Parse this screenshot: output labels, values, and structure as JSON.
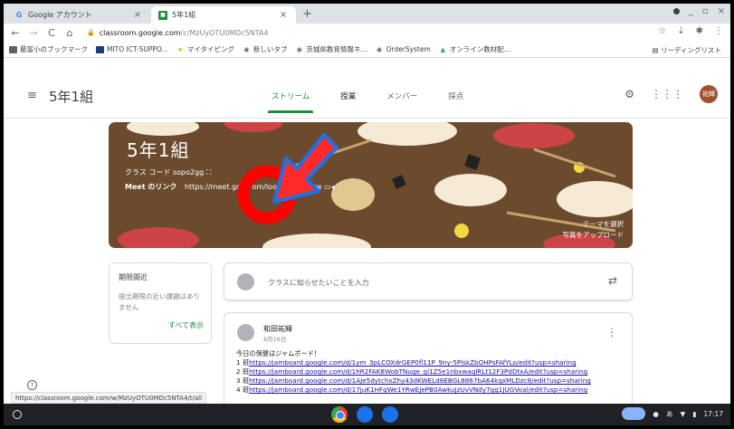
{
  "browser": {
    "tabs": [
      {
        "title": "Google アカウント",
        "active": false
      },
      {
        "title": "5年1組",
        "active": true
      }
    ],
    "address": {
      "host": "classroom.google.com",
      "path": "/c/MzUyOTU0MDc5NTA4"
    },
    "bookmarks": [
      {
        "label": "最富小のブックマーク",
        "icon": "folder-icon"
      },
      {
        "label": "MITO ICT-SUPPO...",
        "icon": "mito-icon"
      },
      {
        "label": "マイタイピング",
        "icon": "star-icon"
      },
      {
        "label": "新しいタブ",
        "icon": "globe-icon"
      },
      {
        "label": "茨城県教育情報ネ...",
        "icon": "globe-icon"
      },
      {
        "label": "OrderSystem",
        "icon": "globe-icon"
      },
      {
        "label": "オンライン教材配...",
        "icon": "green-icon"
      }
    ],
    "reading_list": "リーディングリスト",
    "status_url": "https://classroom.google.com/w/MzUyOTU0MDc5NTA4/t/all"
  },
  "classroom": {
    "class_name": "5年1組",
    "tabs": [
      "ストリーム",
      "授業",
      "メンバー",
      "採点"
    ],
    "avatar_text": "祐輝",
    "banner": {
      "title": "5年1組",
      "class_code_label": "クラス コード",
      "class_code": "sopo2gg",
      "meet_label": "Meet のリンク",
      "meet_url": "https://meet.goog   om/lookup/eotfc   tw",
      "theme_select": "テーマを選択",
      "upload_photo": "写真をアップロード"
    },
    "upcoming": {
      "title": "期限間近",
      "text": "提出期限の近い課題はありません",
      "view_all": "すべて表示"
    },
    "announce_placeholder": "クラスに知らせたいことを入力",
    "post": {
      "author": "和田祐輝",
      "date": "6月16日",
      "intro": "今日の保健はジャムボード！",
      "links": [
        {
          "label": "1 班",
          "url": "https://jamboard.google.com/d/1ym_3pLCOXdrGEP0fl11P_9ny-5PlskZbOHPsFAfYLo/edit?usp=sharing"
        },
        {
          "label": "2 班",
          "url": "https://jamboard.google.com/d/1hR2FAK8WobTNuqe_gi1Z5e1nbxwaqlRLt12F3PdDtxA/edit?usp=sharing"
        },
        {
          "label": "3 班",
          "url": "https://jamboard.google.com/d/1AJe5dytchxZhy43dKWELd8EBGL8867bA64kqxMLDzc8/edit?usp=sharing"
        },
        {
          "label": "4 班",
          "url": "https://jamboard.google.com/d/17juK1HFqWe1YRwEJePB0AwkuJzUvVNdy7gg1JUGVoal/edit?usp=sharing"
        }
      ]
    }
  },
  "shelf": {
    "time": "17:17",
    "ime": "あ"
  },
  "colors": {
    "accent": "#1e8e3e",
    "banner": "#6b4a2e",
    "annotation": "#ff0000",
    "annotation_arrow": "#1a73e8"
  }
}
